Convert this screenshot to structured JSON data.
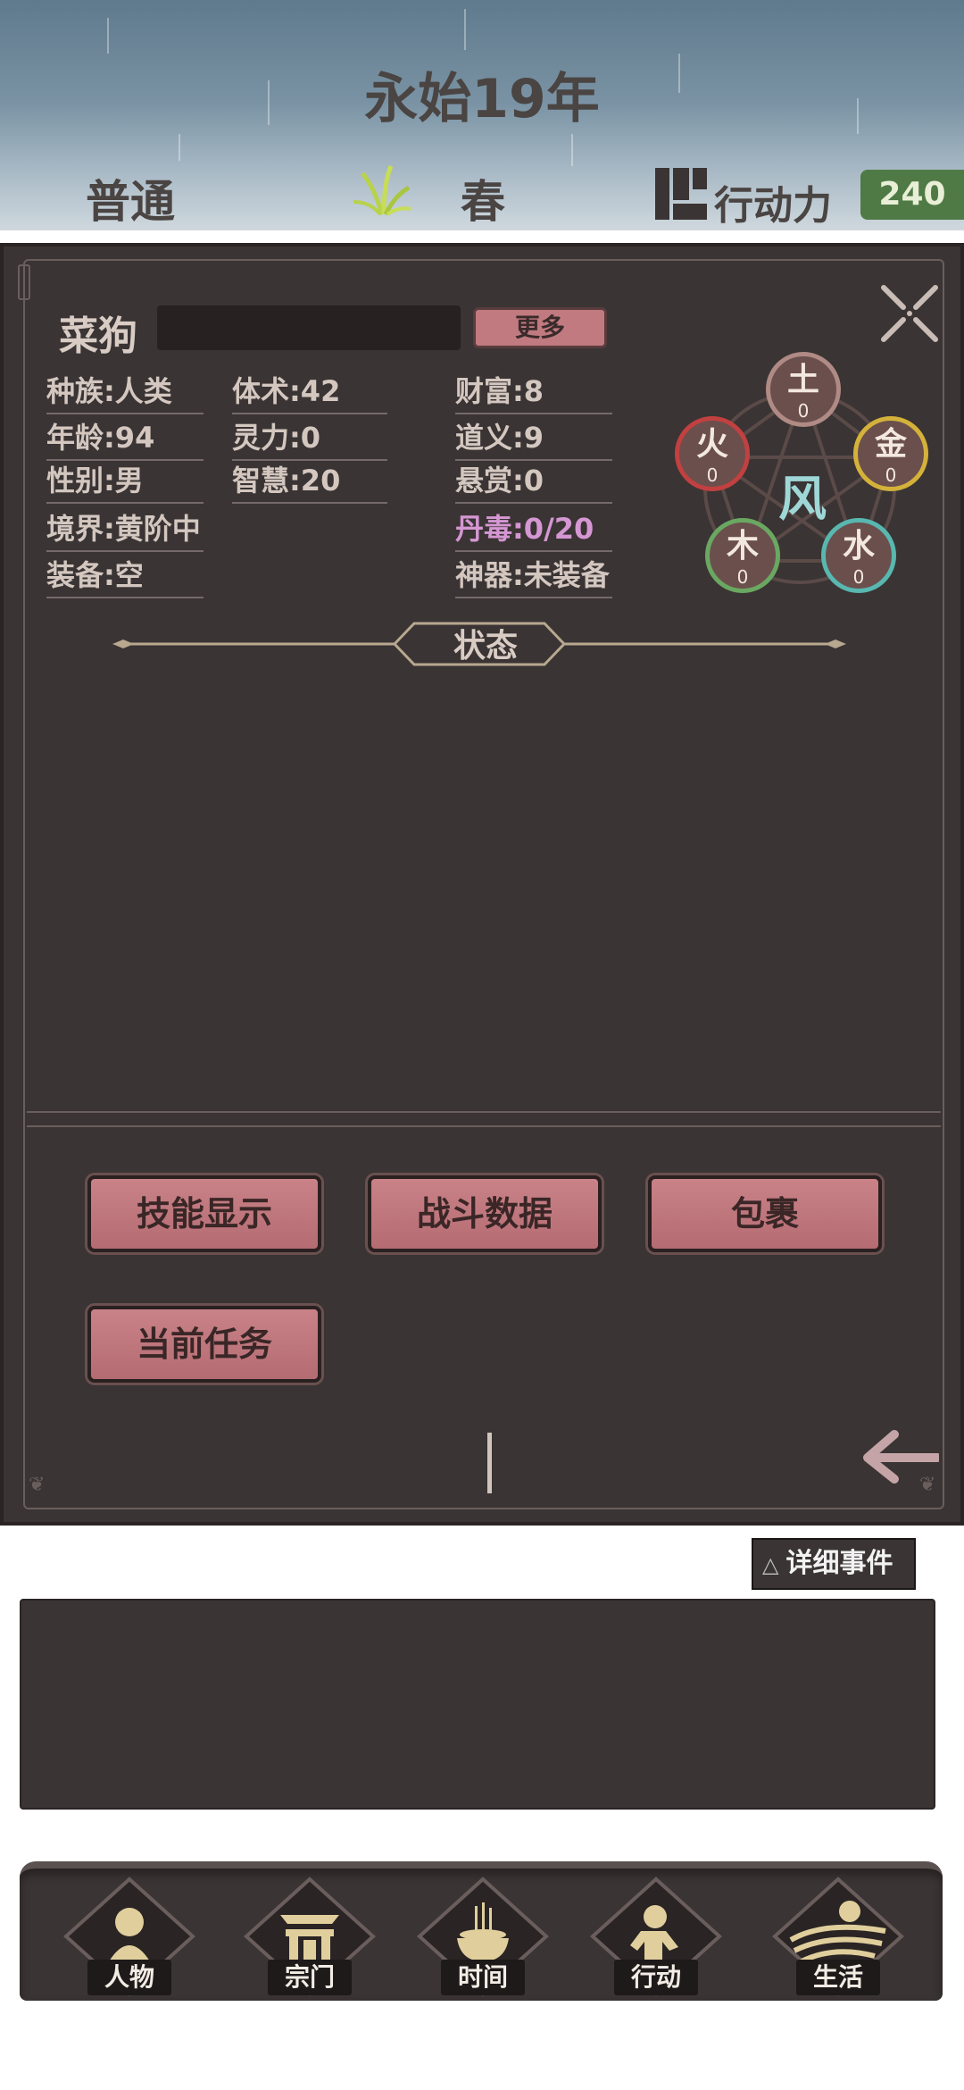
{
  "header": {
    "year": "永始19年",
    "mode": "普通",
    "season": "春",
    "action_points_label": "行动力",
    "action_points_value": "240"
  },
  "character": {
    "name": "菜狗",
    "more_button": "更多",
    "stats": {
      "race": "种族:人类",
      "age": "年龄:94",
      "gender": "性别:男",
      "realm": "境界:黄阶中",
      "equipment": "装备:空",
      "body_art": "体术:42",
      "spirit": "灵力:0",
      "wisdom": "智慧:20",
      "wealth": "财富:8",
      "morality": "道义:9",
      "bounty": "悬赏:0",
      "pill_poison": "丹毒:0/20",
      "artifact": "神器:未装备"
    },
    "elements": {
      "earth": {
        "label": "土",
        "value": "0",
        "color": "#b08a84"
      },
      "metal": {
        "label": "金",
        "value": "0",
        "color": "#d4b23a"
      },
      "water": {
        "label": "水",
        "value": "0",
        "color": "#58b8b0"
      },
      "wood": {
        "label": "木",
        "value": "0",
        "color": "#6aa862"
      },
      "fire": {
        "label": "火",
        "value": "0",
        "color": "#c24040"
      },
      "root": "风"
    },
    "status_title": "状态"
  },
  "actions": {
    "skills": "技能显示",
    "battle_data": "战斗数据",
    "bag": "包裹",
    "current_task": "当前任务"
  },
  "events": {
    "detail_button": "详细事件"
  },
  "nav": [
    {
      "label": "人物",
      "icon": "person-icon"
    },
    {
      "label": "宗门",
      "icon": "sect-gate-icon"
    },
    {
      "label": "时间",
      "icon": "incense-burner-icon"
    },
    {
      "label": "行动",
      "icon": "action-icon"
    },
    {
      "label": "生活",
      "icon": "landscape-icon"
    }
  ]
}
